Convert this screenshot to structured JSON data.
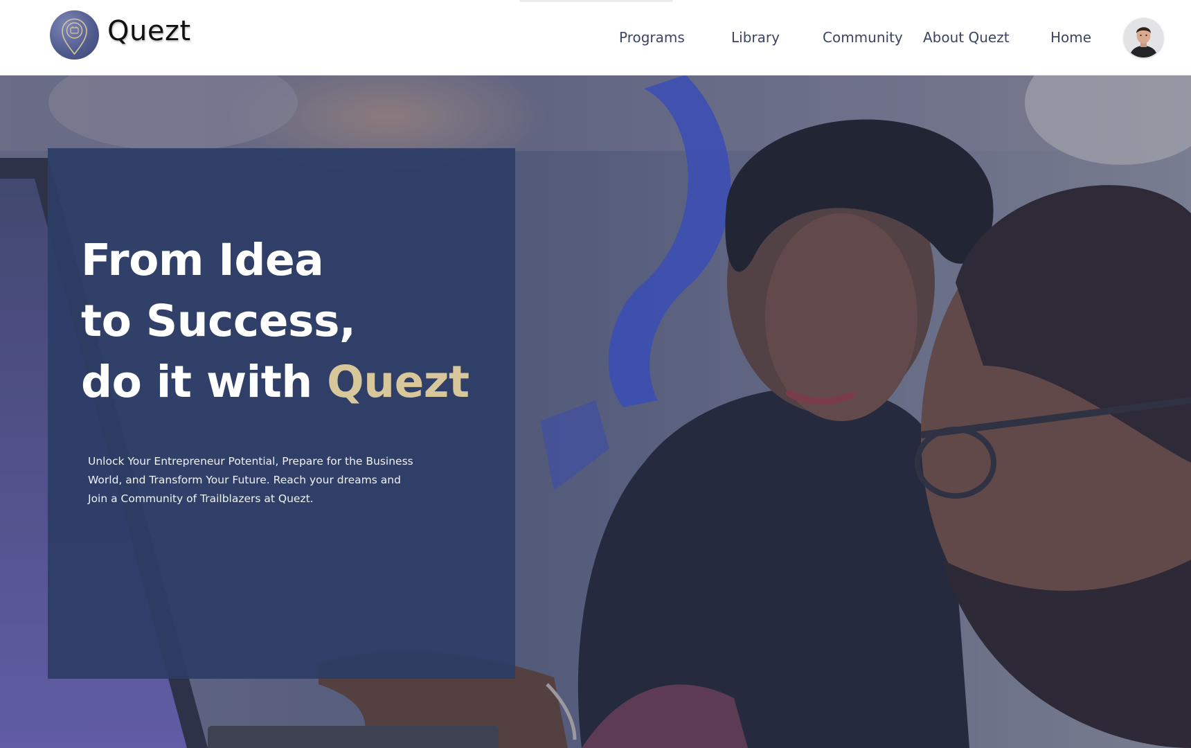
{
  "brand": {
    "name": "Quezt",
    "logo_icon": "location-pin-icon"
  },
  "nav": {
    "items": [
      {
        "label": "Programs"
      },
      {
        "label": "Library"
      },
      {
        "label": "Community"
      },
      {
        "label": "About Quezt"
      },
      {
        "label": "Home"
      }
    ]
  },
  "user": {
    "avatar_icon": "user-avatar"
  },
  "hero": {
    "headline_line1": "From Idea",
    "headline_line2": "to Success,",
    "headline_line3_prefix": "do it with ",
    "headline_line3_accent": "Quezt",
    "subtext": "Unlock Your Entrepreneur Potential, Prepare for the Business World, and Transform Your Future. Reach your dreams and Join a Community of Trailblazers at Quezt."
  },
  "colors": {
    "overlay": "#2c3d66",
    "accent": "#d8c79a",
    "nav_text": "#3b4461",
    "logo_badge": "#4f5a8c"
  }
}
